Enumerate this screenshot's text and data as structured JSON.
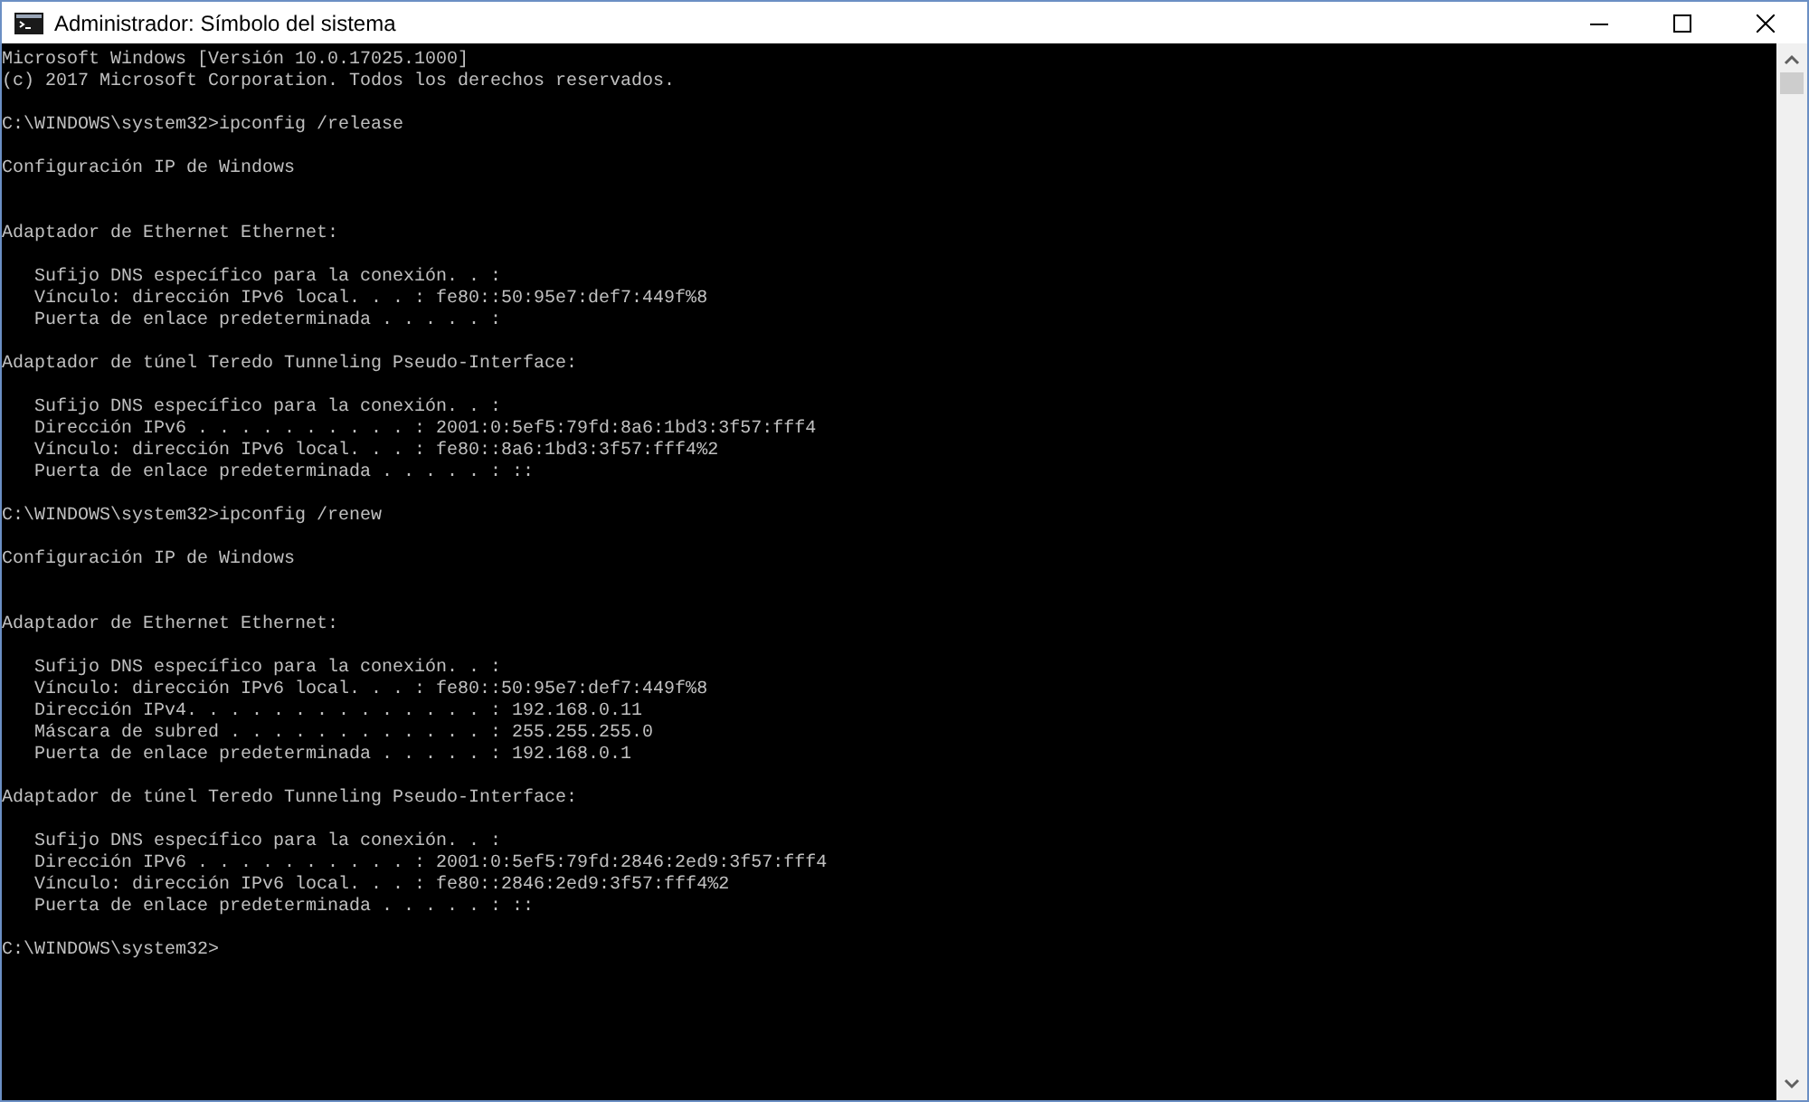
{
  "window": {
    "title": "Administrador: Símbolo del sistema"
  },
  "console": {
    "banner": [
      "Microsoft Windows [Versión 10.0.17025.1000]",
      "(c) 2017 Microsoft Corporation. Todos los derechos reservados."
    ],
    "sessions": [
      {
        "prompt": "C:\\WINDOWS\\system32>ipconfig /release",
        "heading": "Configuración IP de Windows",
        "adapters": [
          {
            "name": "Adaptador de Ethernet Ethernet:",
            "entries": [
              "   Sufijo DNS específico para la conexión. . :",
              "   Vínculo: dirección IPv6 local. . . : fe80::50:95e7:def7:449f%8",
              "   Puerta de enlace predeterminada . . . . . :"
            ]
          },
          {
            "name": "Adaptador de túnel Teredo Tunneling Pseudo-Interface:",
            "entries": [
              "   Sufijo DNS específico para la conexión. . :",
              "   Dirección IPv6 . . . . . . . . . . : 2001:0:5ef5:79fd:8a6:1bd3:3f57:fff4",
              "   Vínculo: dirección IPv6 local. . . : fe80::8a6:1bd3:3f57:fff4%2",
              "   Puerta de enlace predeterminada . . . . . : ::"
            ]
          }
        ]
      },
      {
        "prompt": "C:\\WINDOWS\\system32>ipconfig /renew",
        "heading": "Configuración IP de Windows",
        "adapters": [
          {
            "name": "Adaptador de Ethernet Ethernet:",
            "entries": [
              "   Sufijo DNS específico para la conexión. . :",
              "   Vínculo: dirección IPv6 local. . . : fe80::50:95e7:def7:449f%8",
              "   Dirección IPv4. . . . . . . . . . . . . . : 192.168.0.11",
              "   Máscara de subred . . . . . . . . . . . . : 255.255.255.0",
              "   Puerta de enlace predeterminada . . . . . : 192.168.0.1"
            ]
          },
          {
            "name": "Adaptador de túnel Teredo Tunneling Pseudo-Interface:",
            "entries": [
              "   Sufijo DNS específico para la conexión. . :",
              "   Dirección IPv6 . . . . . . . . . . : 2001:0:5ef5:79fd:2846:2ed9:3f57:fff4",
              "   Vínculo: dirección IPv6 local. . . : fe80::2846:2ed9:3f57:fff4%2",
              "   Puerta de enlace predeterminada . . . . . : ::"
            ]
          }
        ]
      }
    ],
    "final_prompt": "C:\\WINDOWS\\system32>"
  }
}
